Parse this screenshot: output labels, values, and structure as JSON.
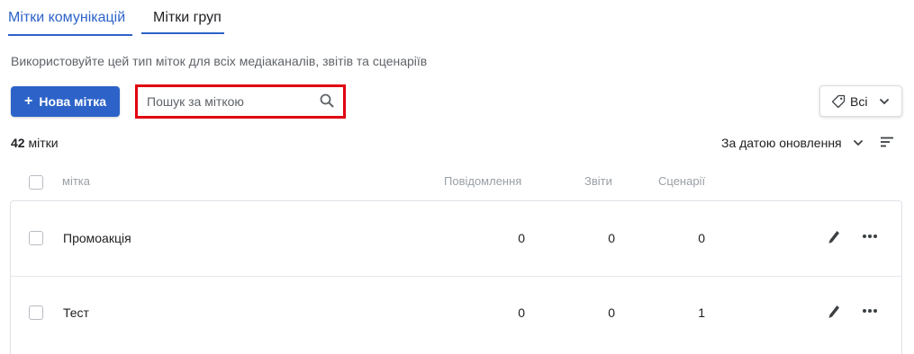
{
  "tabs": [
    {
      "label": "Мітки комунікацій",
      "active": true
    },
    {
      "label": "Мітки груп",
      "active": false
    }
  ],
  "description": "Використовуйте цей тип міток для всіх медіаканалів, звітів та сценаріїв",
  "toolbar": {
    "add_button_label": "Нова мітка",
    "add_button_icon": "plus-icon",
    "search_placeholder": "Пошук за міткою",
    "search_icon": "search-icon",
    "filter_icon": "tag-icon",
    "filter_label": "Всі"
  },
  "summary": {
    "count": "42",
    "count_suffix": "мітки",
    "sort_label": "За датою оновлення"
  },
  "table": {
    "columns": {
      "name": "мітка",
      "messages": "Повідомлення",
      "reports": "Звіти",
      "scenarios": "Сценарії"
    },
    "rows": [
      {
        "name": "Промоакція",
        "messages": "0",
        "reports": "0",
        "scenarios": "0"
      },
      {
        "name": "Тест",
        "messages": "0",
        "reports": "0",
        "scenarios": "1"
      }
    ]
  },
  "colors": {
    "accent": "#2d63c8",
    "highlight": "#e00010"
  }
}
